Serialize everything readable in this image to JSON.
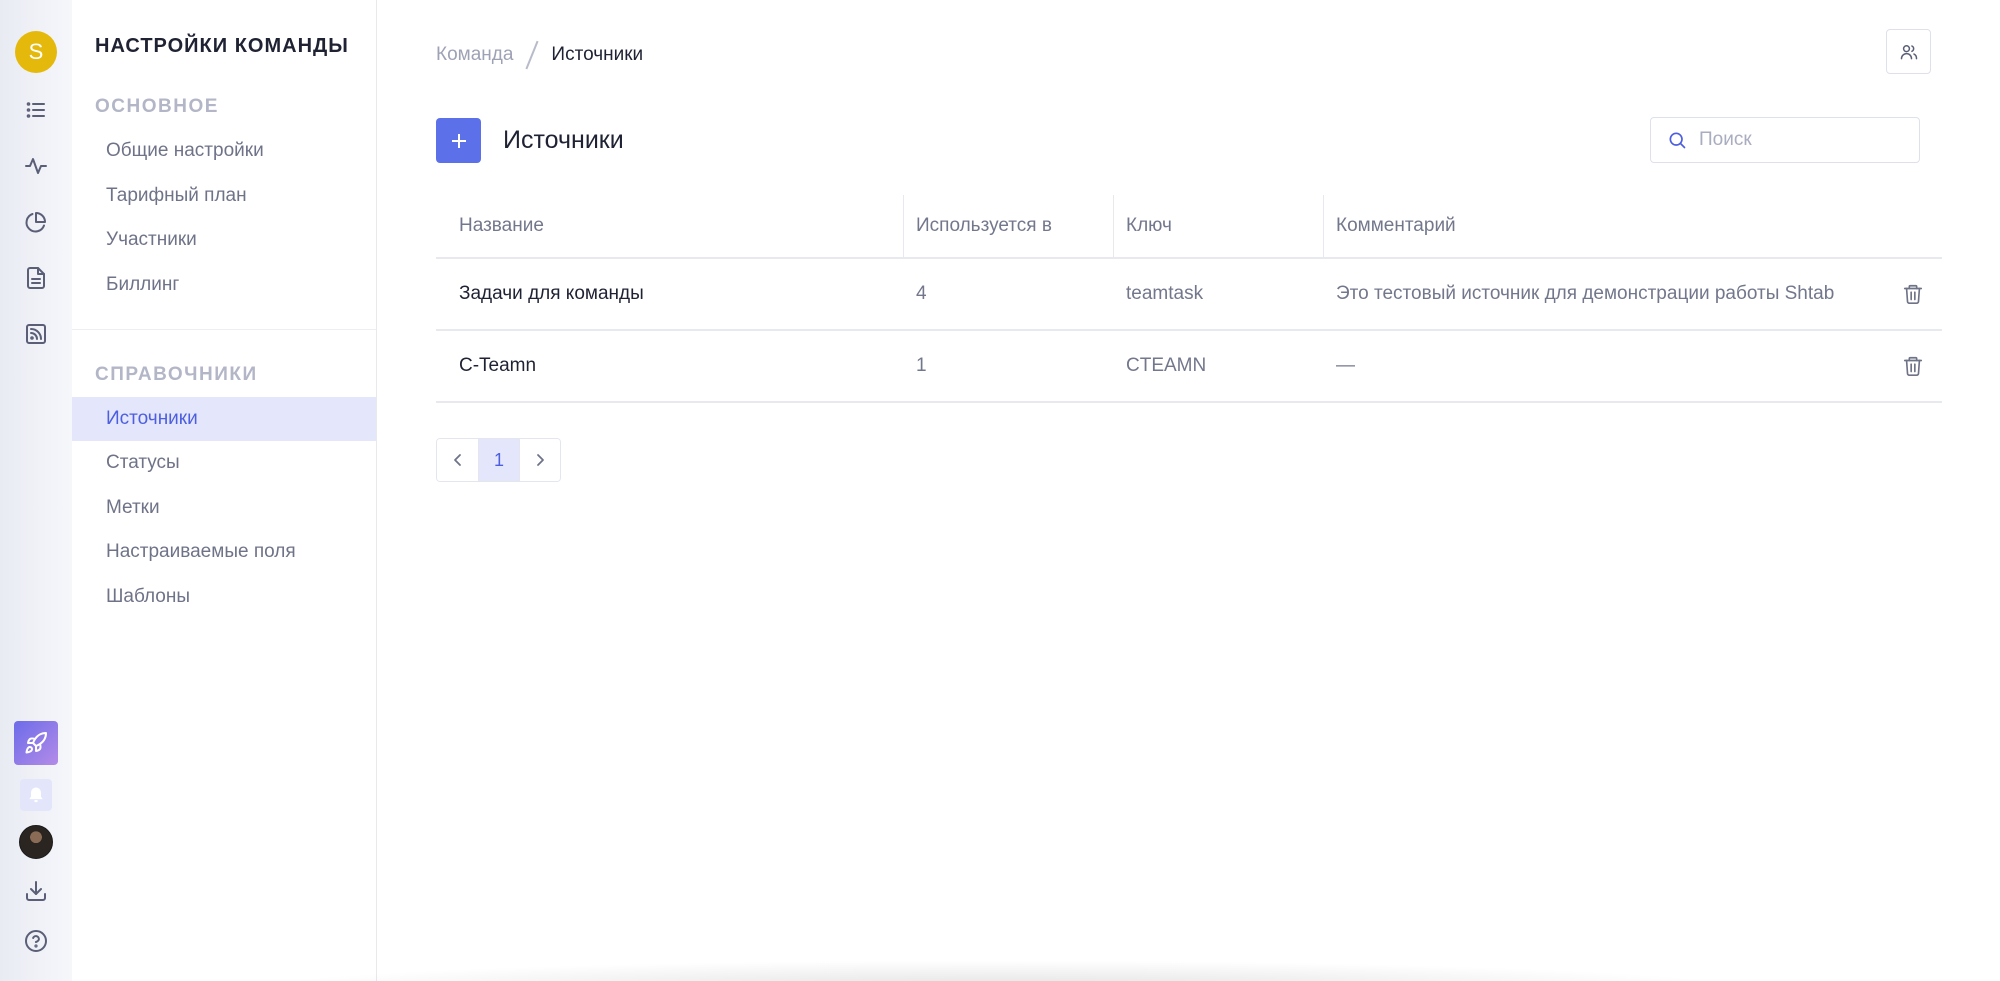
{
  "rail": {
    "team_initial": "S",
    "colors": {
      "team_avatar": "#e5b90b",
      "rocket_gradient_start": "#6c6ce9",
      "rocket_gradient_end": "#b48be8"
    },
    "top_icons": [
      "list-icon",
      "activity-icon",
      "pie-chart-icon",
      "document-icon",
      "rss-icon"
    ],
    "bottom_icons": [
      "rocket-icon",
      "bell-icon",
      "user-avatar",
      "download-icon",
      "help-icon"
    ]
  },
  "sidenav": {
    "title": "НАСТРОЙКИ КОМАНДЫ",
    "sections": [
      {
        "label": "ОСНОВНОЕ",
        "items": [
          {
            "label": "Общие настройки",
            "active": false
          },
          {
            "label": "Тарифный план",
            "active": false
          },
          {
            "label": "Участники",
            "active": false
          },
          {
            "label": "Биллинг",
            "active": false
          }
        ]
      },
      {
        "label": "СПРАВОЧНИКИ",
        "items": [
          {
            "label": "Источники",
            "active": true
          },
          {
            "label": "Статусы",
            "active": false
          },
          {
            "label": "Метки",
            "active": false
          },
          {
            "label": "Настраиваемые поля",
            "active": false
          },
          {
            "label": "Шаблоны",
            "active": false
          }
        ]
      }
    ]
  },
  "breadcrumb": {
    "parent": "Команда",
    "current": "Источники"
  },
  "header": {
    "title": "Источники",
    "search_placeholder": "Поиск",
    "colors": {
      "accent": "#5c70ea"
    }
  },
  "table": {
    "columns": [
      "Название",
      "Используется в",
      "Ключ",
      "Комментарий"
    ],
    "rows": [
      {
        "name": "Задачи для команды",
        "used_in": "4",
        "key": "teamtask",
        "comment": "Это тестовый источник для демонстрации работы Shtab"
      },
      {
        "name": "C-Teamn",
        "used_in": "1",
        "key": "CTEAMN",
        "comment": "—"
      }
    ]
  },
  "pagination": {
    "pages": [
      "1"
    ],
    "current": "1"
  }
}
